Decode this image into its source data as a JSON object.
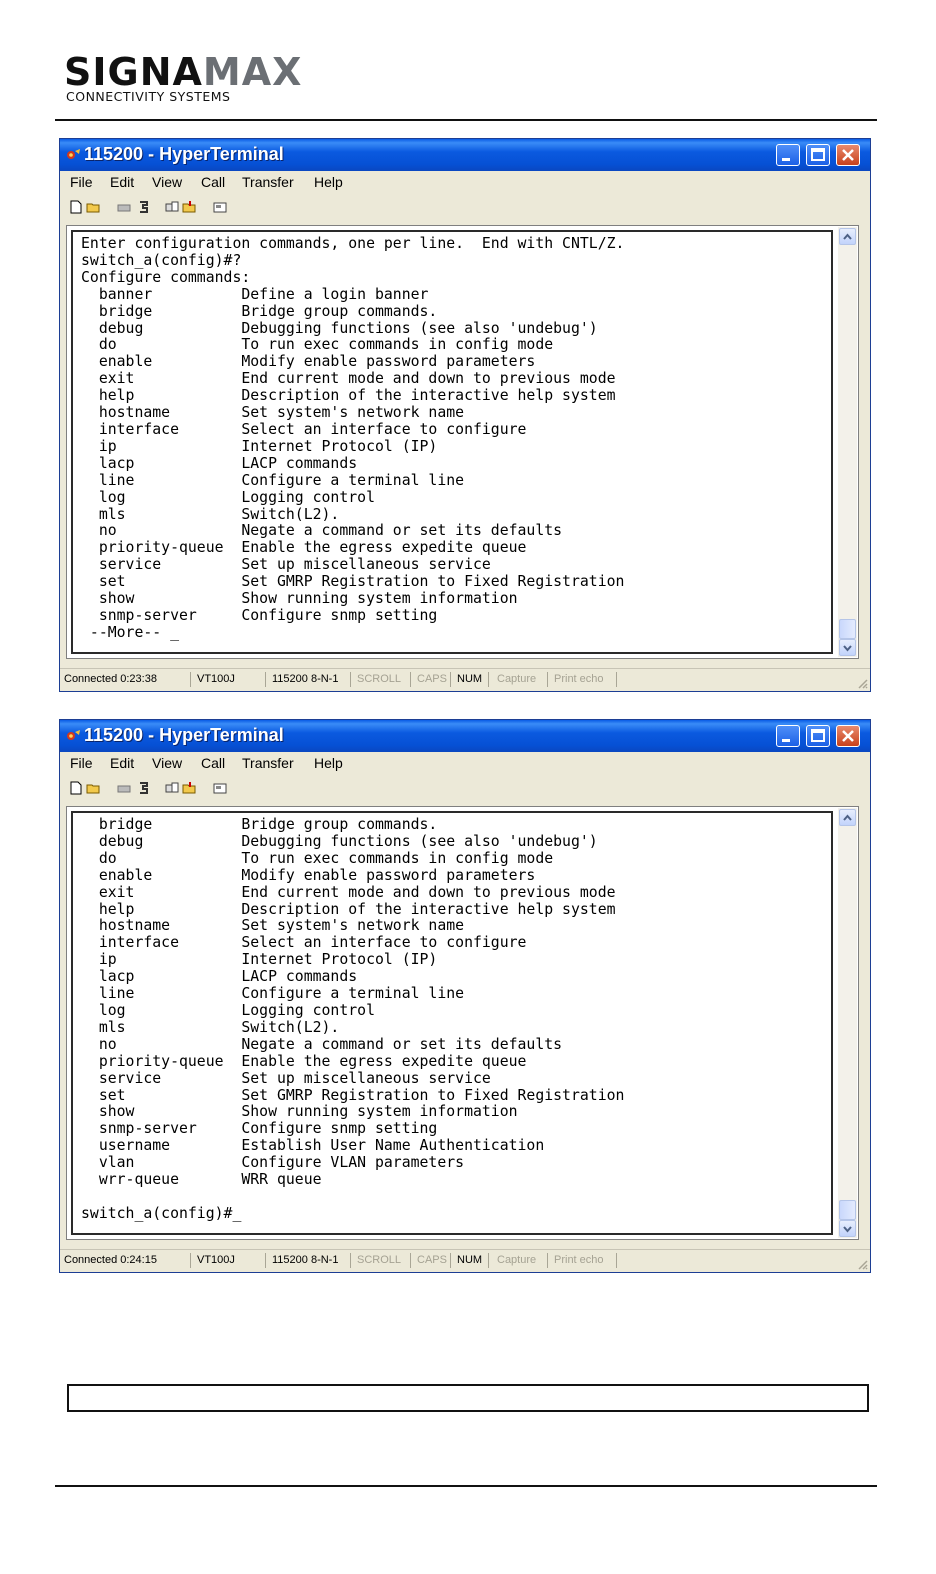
{
  "header": {
    "logo_main_a": "SIGNA",
    "logo_main_b": "MAX",
    "logo_sub": "CONNECTIVITY SYSTEMS"
  },
  "windows": [
    {
      "title": "115200 - HyperTerminal",
      "menu": [
        "File",
        "Edit",
        "View",
        "Call",
        "Transfer",
        "Help"
      ],
      "terminal_text": "Enter configuration commands, one per line.  End with CNTL/Z.\nswitch_a(config)#?\nConfigure commands:\n  banner          Define a login banner\n  bridge          Bridge group commands.\n  debug           Debugging functions (see also 'undebug')\n  do              To run exec commands in config mode\n  enable          Modify enable password parameters\n  exit            End current mode and down to previous mode\n  help            Description of the interactive help system\n  hostname        Set system's network name\n  interface       Select an interface to configure\n  ip              Internet Protocol (IP)\n  lacp            LACP commands\n  line            Configure a terminal line\n  log             Logging control\n  mls             Switch(L2).\n  no              Negate a command or set its defaults\n  priority-queue  Enable the egress expedite queue\n  service         Set up miscellaneous service\n  set             Set GMRP Registration to Fixed Registration\n  show            Show running system information\n  snmp-server     Configure snmp setting\n --More-- _",
      "status": {
        "connected": "Connected 0:23:38",
        "emulation": "VT100J",
        "settings": "115200 8-N-1",
        "scroll": "SCROLL",
        "caps": "CAPS",
        "num": "NUM",
        "capture": "Capture",
        "print_echo": "Print echo"
      }
    },
    {
      "title": "115200 - HyperTerminal",
      "menu": [
        "File",
        "Edit",
        "View",
        "Call",
        "Transfer",
        "Help"
      ],
      "terminal_text": "  bridge          Bridge group commands.\n  debug           Debugging functions (see also 'undebug')\n  do              To run exec commands in config mode\n  enable          Modify enable password parameters\n  exit            End current mode and down to previous mode\n  help            Description of the interactive help system\n  hostname        Set system's network name\n  interface       Select an interface to configure\n  ip              Internet Protocol (IP)\n  lacp            LACP commands\n  line            Configure a terminal line\n  log             Logging control\n  mls             Switch(L2).\n  no              Negate a command or set its defaults\n  priority-queue  Enable the egress expedite queue\n  service         Set up miscellaneous service\n  set             Set GMRP Registration to Fixed Registration\n  show            Show running system information\n  snmp-server     Configure snmp setting\n  username        Establish User Name Authentication\n  vlan            Configure VLAN parameters\n  wrr-queue       WRR queue\n\nswitch_a(config)#_",
      "status": {
        "connected": "Connected 0:24:15",
        "emulation": "VT100J",
        "settings": "115200 8-N-1",
        "scroll": "SCROLL",
        "caps": "CAPS",
        "num": "NUM",
        "capture": "Capture",
        "print_echo": "Print echo"
      }
    }
  ],
  "colors": {
    "titlebar": "#0650d4",
    "window_face": "#ece9d8",
    "close_button": "#c8411c"
  },
  "icons": [
    "hyperterminal-app-icon",
    "minimize-icon",
    "maximize-icon",
    "close-icon",
    "new-icon",
    "open-icon",
    "disconnect-icon",
    "dial-icon",
    "send-icon",
    "receive-icon",
    "properties-icon",
    "scroll-up-icon",
    "scroll-down-icon",
    "resize-grip-icon"
  ]
}
